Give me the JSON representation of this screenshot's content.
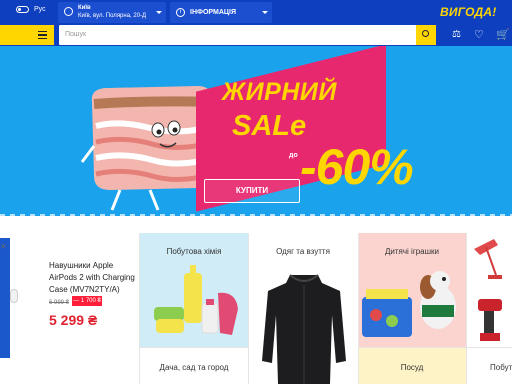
{
  "header": {
    "lang": "Рус",
    "city_name": "Київ",
    "city_address": "Київ, вул. Полярна, 20-Д",
    "info_label": "ІНФОРМАЦІЯ",
    "logo_text": "ВИГОДА!"
  },
  "search": {
    "placeholder": "Пошук"
  },
  "banner": {
    "headline_line1": "ЖИРНИЙ",
    "headline_line2": "SALe",
    "do_label": "до",
    "discount": "-60%",
    "buy_label": "КУПИТИ"
  },
  "featured": {
    "title": "Навушники Apple AirPods 2 with Charging Case (MV7N2TY/A)",
    "old_price": "6 999 ₴",
    "discount_badge": "— 1 700 ₴",
    "new_price": "5 299 ₴"
  },
  "categories": [
    {
      "label": "Побутова хімія"
    },
    {
      "label": "Одяг та взуття"
    },
    {
      "label": "Дитячі іграшки"
    },
    {
      "label": "Дача, сад та город"
    },
    {
      "label": "Посуд"
    },
    {
      "label": "Побут"
    }
  ],
  "colors": {
    "header_blue": "#0d3fbf",
    "accent_yellow": "#ffd600",
    "banner_blue": "#1aa3ec",
    "banner_pink": "#e8286e",
    "price_red": "#e02231"
  }
}
